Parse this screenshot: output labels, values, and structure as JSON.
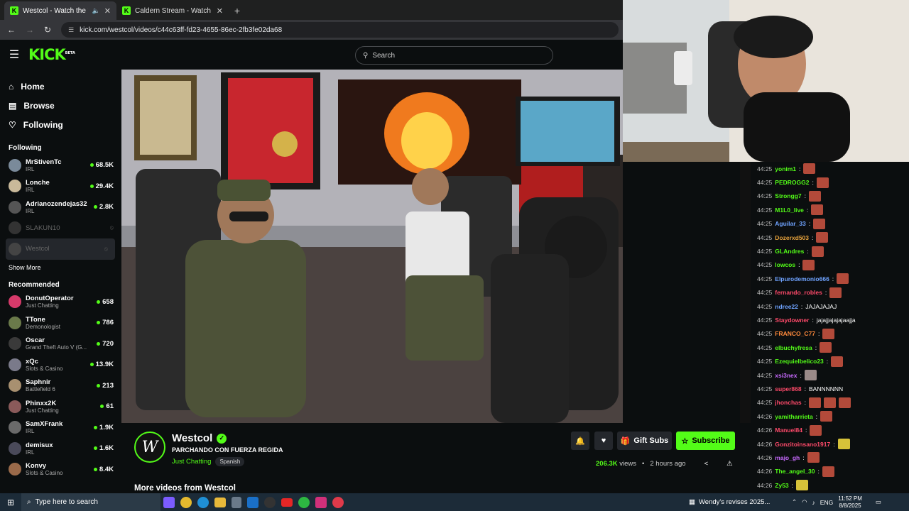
{
  "browser": {
    "tabs": [
      {
        "title": "Westcol - Watch the VOD o",
        "active": true
      },
      {
        "title": "Caldern Stream - Watch Live o",
        "active": false
      }
    ],
    "url": "kick.com/westcol/videos/c44c63ff-fd23-4655-86ec-2fb3fe02da68"
  },
  "header": {
    "logo": "KICK",
    "logo_sup": "BETA",
    "search_placeholder": "Search"
  },
  "nav": [
    {
      "label": "Home",
      "icon": "home-icon"
    },
    {
      "label": "Browse",
      "icon": "browse-icon"
    },
    {
      "label": "Following",
      "icon": "heart-icon"
    }
  ],
  "following": {
    "title": "Following",
    "channels": [
      {
        "name": "MrStivenTc",
        "category": "IRL",
        "viewers": "68.5K",
        "live": true,
        "color": "#7a8a9a"
      },
      {
        "name": "Lonche",
        "category": "IRL",
        "viewers": "29.4K",
        "live": true,
        "color": "#c9b99a"
      },
      {
        "name": "Adrianozendejas32",
        "category": "IRL",
        "viewers": "2.8K",
        "live": true,
        "color": "#555"
      },
      {
        "name": "SLAKUN10",
        "category": "",
        "viewers": "",
        "live": false,
        "color": "#333"
      },
      {
        "name": "Westcol",
        "category": "",
        "viewers": "",
        "live": false,
        "color": "#444"
      }
    ],
    "show_more": "Show More"
  },
  "recommended": {
    "title": "Recommended",
    "channels": [
      {
        "name": "DonutOperator",
        "category": "Just Chatting",
        "viewers": "658",
        "color": "#d63a6a"
      },
      {
        "name": "TTone",
        "category": "Demonologist",
        "viewers": "786",
        "color": "#6a7a4a"
      },
      {
        "name": "Oscar",
        "category": "Grand Theft Auto V (G...",
        "viewers": "720",
        "color": "#3a3a3a"
      },
      {
        "name": "xQc",
        "category": "Slots & Casino",
        "viewers": "13.9K",
        "color": "#7a7a8a"
      },
      {
        "name": "Saphnir",
        "category": "Battlefield 6",
        "viewers": "213",
        "color": "#a89070"
      },
      {
        "name": "Phinxx2K",
        "category": "Just Chatting",
        "viewers": "61",
        "color": "#8a5a5a"
      },
      {
        "name": "SamXFrank",
        "category": "IRL",
        "viewers": "1.9K",
        "color": "#6a6a6a"
      },
      {
        "name": "demisux",
        "category": "IRL",
        "viewers": "1.6K",
        "color": "#4a4a5a"
      },
      {
        "name": "Konvy",
        "category": "Slots & Casino",
        "viewers": "8.4K",
        "color": "#9a6a4a"
      }
    ]
  },
  "stream": {
    "channel": "Westcol",
    "title": "PARCHANDO CON FUERZA REGIDA",
    "category": "Just Chatting",
    "language": "Spanish",
    "gift_label": "Gift Subs",
    "subscribe_label": "Subscribe",
    "views": "206.3K",
    "views_label": "views",
    "ago": "2 hours ago",
    "more_videos": "More videos from Westcol"
  },
  "chat": [
    {
      "time": "44:25",
      "user": "yonim1",
      "color": "#53fc18",
      "text": "",
      "emotes": [
        "r"
      ]
    },
    {
      "time": "44:25",
      "user": "PEDROGG2",
      "color": "#53fc18",
      "text": "",
      "emotes": [
        "r"
      ]
    },
    {
      "time": "44:25",
      "user": "Strongg7",
      "color": "#53fc18",
      "text": "",
      "emotes": [
        "r"
      ]
    },
    {
      "time": "44:25",
      "user": "M1L0_live",
      "color": "#53fc18",
      "text": "",
      "emotes": [
        "r"
      ]
    },
    {
      "time": "44:25",
      "user": "Aguilar_33",
      "color": "#6fa3ff",
      "text": "",
      "emotes": [
        "r"
      ]
    },
    {
      "time": "44:25",
      "user": "Dozerxd503",
      "color": "#e8a33c",
      "text": "",
      "emotes": [
        "r"
      ]
    },
    {
      "time": "44:25",
      "user": "GLAndres",
      "color": "#53fc18",
      "text": "",
      "emotes": [
        "r"
      ]
    },
    {
      "time": "44:25",
      "user": "lowcos",
      "color": "#53fc18",
      "text": "",
      "emotes": [
        "r"
      ]
    },
    {
      "time": "44:25",
      "user": "Elpurodemonio666",
      "color": "#6fa3ff",
      "text": "",
      "emotes": [
        "r"
      ]
    },
    {
      "time": "44:25",
      "user": "fernando_robles",
      "color": "#ff4a6a",
      "text": "",
      "emotes": [
        "r"
      ]
    },
    {
      "time": "44:25",
      "user": "ndree22",
      "color": "#6fa3ff",
      "text": "JAJAJAJAJ",
      "emotes": []
    },
    {
      "time": "44:25",
      "user": "Staydowner",
      "color": "#ff4a6a",
      "text": "jajajjajajajaajja",
      "emotes": []
    },
    {
      "time": "44:25",
      "user": "FRANCO_C77",
      "color": "#ff8a3c",
      "text": "",
      "emotes": [
        "r"
      ]
    },
    {
      "time": "44:25",
      "user": "elbuchyfresa",
      "color": "#53fc18",
      "text": "",
      "emotes": [
        "r"
      ]
    },
    {
      "time": "44:25",
      "user": "Ezequielbelico23",
      "color": "#53fc18",
      "text": "",
      "emotes": [
        "r"
      ]
    },
    {
      "time": "44:25",
      "user": "xsi3nex",
      "color": "#c86aff",
      "text": "",
      "emotes": [
        "g"
      ]
    },
    {
      "time": "44:25",
      "user": "super868",
      "color": "#ff4a6a",
      "text": "BANNNNNN",
      "emotes": []
    },
    {
      "time": "44:25",
      "user": "jhonchas",
      "color": "#ff4a6a",
      "text": "",
      "emotes": [
        "r",
        "r",
        "r"
      ]
    },
    {
      "time": "44:26",
      "user": "yamitharrieta",
      "color": "#53fc18",
      "text": "",
      "emotes": [
        "r"
      ]
    },
    {
      "time": "44:26",
      "user": "Manuel84",
      "color": "#ff4a6a",
      "text": "",
      "emotes": [
        "r"
      ]
    },
    {
      "time": "44:26",
      "user": "Gonzitoinsano1917",
      "color": "#ff4a6a",
      "text": "",
      "emotes": [
        "b"
      ]
    },
    {
      "time": "44:26",
      "user": "majo_gh",
      "color": "#c86aff",
      "text": "",
      "emotes": [
        "r"
      ]
    },
    {
      "time": "44:26",
      "user": "The_angel_30",
      "color": "#53fc18",
      "text": "",
      "emotes": [
        "r"
      ]
    },
    {
      "time": "44:26",
      "user": "Zy53",
      "color": "#53fc18",
      "text": "",
      "emotes": [
        "b"
      ]
    }
  ],
  "taskbar": {
    "search_placeholder": "Type here to search",
    "news": "Wendy's revises 2025...",
    "lang": "ENG",
    "time": "11:52 PM",
    "date": "8/8/2025"
  }
}
